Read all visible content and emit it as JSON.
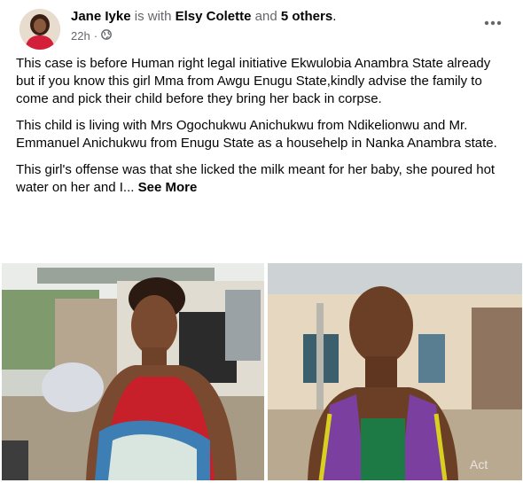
{
  "post": {
    "author": "Jane Iyke",
    "is_with": "is with",
    "tagged_person": "Elsy Colette",
    "and_text": "and",
    "others": "5 others",
    "end_punct": ".",
    "time": "22h",
    "dot": "·",
    "privacy_icon": "globe-icon",
    "more_icon": "ellipsis-icon",
    "paragraphs": [
      "This case is before Human right legal initiative Ekwulobia Anambra State already but if you know this girl Mma from Awgu Enugu State,kindly advise the family to come and pick their child before they bring her back in corpse.",
      "This child is living with  Mrs Ogochukwu Anichukwu from Ndikelionwu and Mr. Emmanuel Anichukwu from Enugu State as a househelp in Nanka Anambra state."
    ],
    "last_paragraph": "This girl's offense was that she licked the milk meant for her baby, she poured hot water on her and I...",
    "see_more": "See More",
    "watermark": "Act"
  }
}
